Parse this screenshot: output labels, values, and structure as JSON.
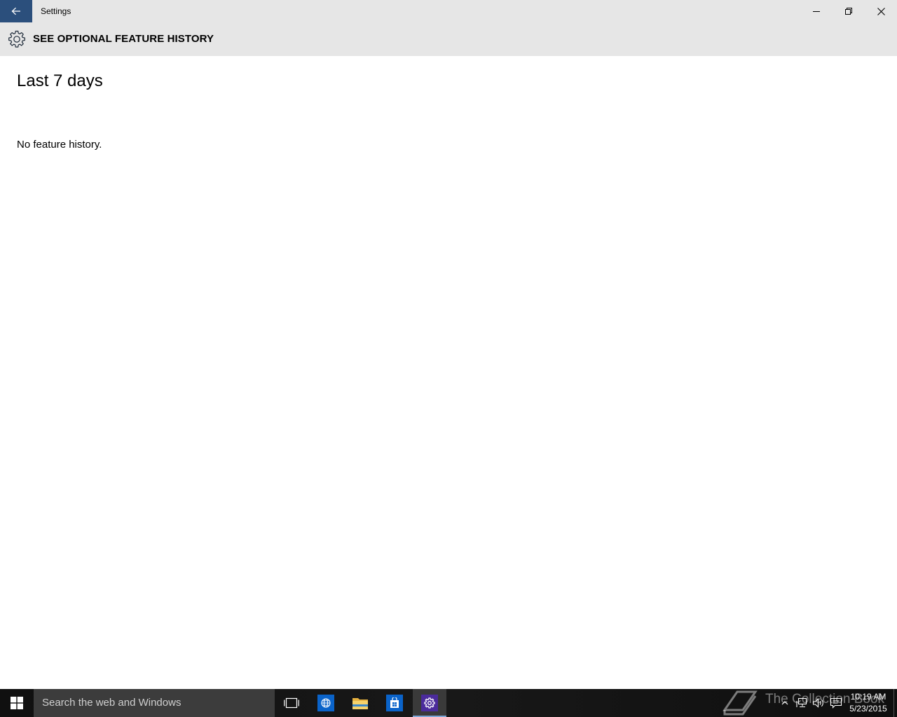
{
  "window": {
    "app_title": "Settings",
    "colors": {
      "accent": "#2b4f7c",
      "chrome": "#e6e6e6"
    }
  },
  "header": {
    "title": "SEE OPTIONAL FEATURE HISTORY",
    "icon": "gear-icon"
  },
  "content": {
    "section_heading": "Last 7 days",
    "empty_message": "No feature history."
  },
  "taskbar": {
    "search_placeholder": "Search the web and Windows",
    "pinned": [
      "task-view-icon",
      "internet-explorer-icon",
      "file-explorer-icon",
      "store-icon",
      "settings-icon"
    ],
    "active_app": "Settings",
    "watermark": "The Collection Book",
    "clock": {
      "time": "10:19 AM",
      "date": "5/23/2015"
    }
  }
}
